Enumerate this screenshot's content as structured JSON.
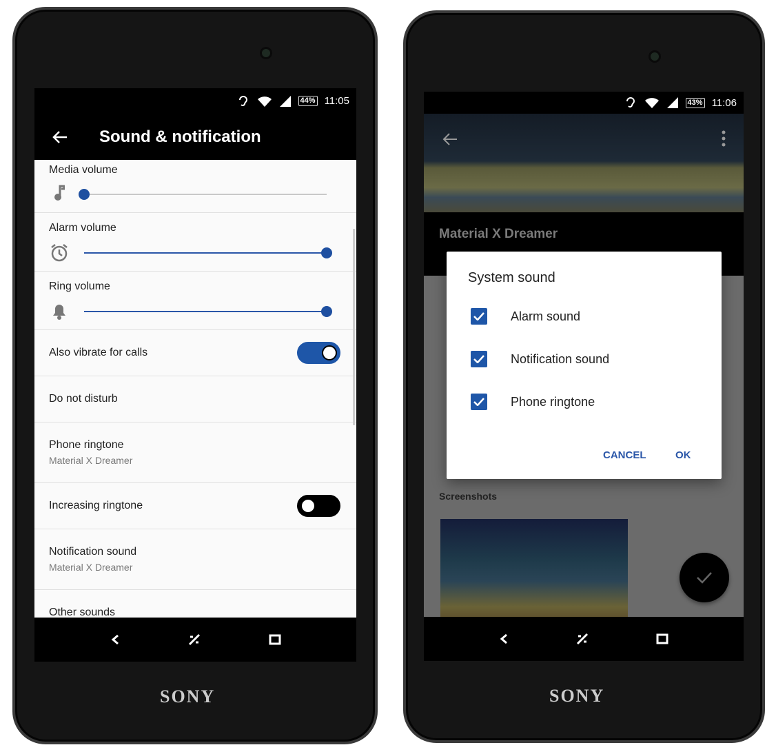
{
  "left_phone": {
    "brand": "SONY",
    "status": {
      "time": "11:05",
      "battery": "44%"
    },
    "toolbar": {
      "title": "Sound & notification"
    },
    "settings": [
      {
        "label": "Media volume",
        "icon": "music-note-icon",
        "level": 0
      },
      {
        "label": "Alarm volume",
        "icon": "alarm-clock-icon",
        "level": 1
      },
      {
        "label": "Ring volume",
        "icon": "bell-icon",
        "level": 1
      },
      {
        "label": "Also vibrate for calls",
        "toggle": true
      },
      {
        "label": "Do not disturb"
      },
      {
        "label": "Phone ringtone",
        "value": "Material X Dreamer"
      },
      {
        "label": "Increasing ringtone",
        "toggle": false
      },
      {
        "label": "Notification sound",
        "value": "Material X Dreamer"
      },
      {
        "label": "Other sounds"
      }
    ],
    "accent": "#2a56a8"
  },
  "right_phone": {
    "brand": "SONY",
    "status": {
      "time": "11:06",
      "battery": "43%"
    },
    "app_title": "Material X Dreamer",
    "section": "Screenshots",
    "dialog": {
      "title": "System sound",
      "options": [
        {
          "label": "Alarm sound",
          "checked": true
        },
        {
          "label": "Notification sound",
          "checked": true
        },
        {
          "label": "Phone ringtone",
          "checked": true
        }
      ],
      "cancel": "CANCEL",
      "ok": "OK"
    }
  }
}
